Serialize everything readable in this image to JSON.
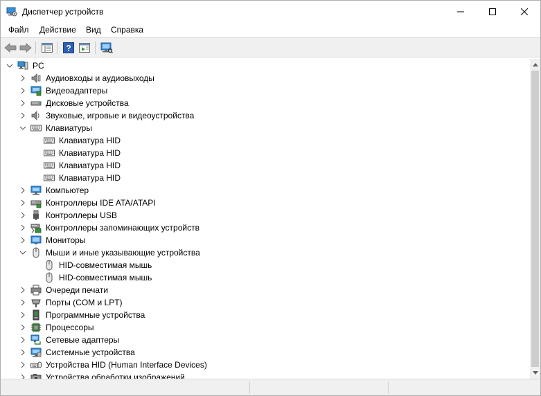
{
  "window": {
    "title": "Диспетчер устройств"
  },
  "menu": {
    "file": "Файл",
    "action": "Действие",
    "view": "Вид",
    "help": "Справка"
  },
  "tree": {
    "root": "PC",
    "items": [
      {
        "label": "Аудиовходы и аудиовыходы",
        "icon": "audio-io-icon",
        "expanded": false
      },
      {
        "label": "Видеоадаптеры",
        "icon": "display-adapter-icon",
        "expanded": false
      },
      {
        "label": "Дисковые устройства",
        "icon": "disk-drive-icon",
        "expanded": false
      },
      {
        "label": "Звуковые, игровые и видеоустройства",
        "icon": "speaker-icon",
        "expanded": false
      },
      {
        "label": "Клавиатуры",
        "icon": "keyboard-icon",
        "expanded": true,
        "children": [
          "Клавиатура HID",
          "Клавиатура HID",
          "Клавиатура HID",
          "Клавиатура HID"
        ]
      },
      {
        "label": "Компьютер",
        "icon": "computer-icon",
        "expanded": false
      },
      {
        "label": "Контроллеры IDE ATA/ATAPI",
        "icon": "ide-controller-icon",
        "expanded": false
      },
      {
        "label": "Контроллеры USB",
        "icon": "usb-icon",
        "expanded": false
      },
      {
        "label": "Контроллеры запоминающих устройств",
        "icon": "storage-controller-icon",
        "expanded": false
      },
      {
        "label": "Мониторы",
        "icon": "monitor-icon",
        "expanded": false
      },
      {
        "label": "Мыши и иные указывающие устройства",
        "icon": "mouse-icon",
        "expanded": true,
        "children": [
          "HID-совместимая мышь",
          "HID-совместимая мышь"
        ]
      },
      {
        "label": "Очереди печати",
        "icon": "printer-icon",
        "expanded": false
      },
      {
        "label": "Порты (COM и LPT)",
        "icon": "port-icon",
        "expanded": false
      },
      {
        "label": "Программные устройства",
        "icon": "software-device-icon",
        "expanded": false
      },
      {
        "label": "Процессоры",
        "icon": "processor-icon",
        "expanded": false
      },
      {
        "label": "Сетевые адаптеры",
        "icon": "network-adapter-icon",
        "expanded": false
      },
      {
        "label": "Системные устройства",
        "icon": "system-device-icon",
        "expanded": false
      },
      {
        "label": "Устройства HID (Human Interface Devices)",
        "icon": "hid-icon",
        "expanded": false
      },
      {
        "label": "Устройства обработки изображений",
        "icon": "imaging-device-icon",
        "expanded": false
      }
    ]
  },
  "colors": {
    "accent": "#1979ca",
    "toolbar_bg": "#f0f0f0",
    "selection": "#cce8ff"
  }
}
